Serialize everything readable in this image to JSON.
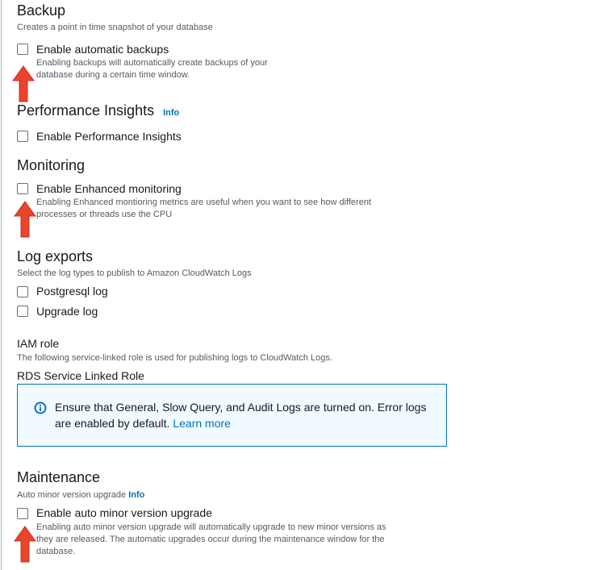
{
  "backup": {
    "title": "Backup",
    "description": "Creates a point in time snapshot of your database",
    "checkbox_label": "Enable automatic backups",
    "checkbox_desc_line1": "Enabling backups will automatically create backups of your",
    "checkbox_desc_line2": "database during a certain time window.",
    "checked": false
  },
  "performance_insights": {
    "title": "Performance Insights",
    "info_label": "Info",
    "checkbox_label": "Enable Performance Insights",
    "checked": false
  },
  "monitoring": {
    "title": "Monitoring",
    "checkbox_label": "Enable Enhanced monitoring",
    "checkbox_desc_line1": "Enabling Enhanced montioring metrics are useful when you want to see how different",
    "checkbox_desc_line2": "processes or threads use the CPU",
    "checked": false
  },
  "log_exports": {
    "title": "Log exports",
    "description": "Select the log types to publish to Amazon CloudWatch Logs",
    "options": [
      {
        "label": "Postgresql log",
        "checked": false
      },
      {
        "label": "Upgrade log",
        "checked": false
      }
    ]
  },
  "iam_role": {
    "title": "IAM role",
    "description": "The following service-linked role is used for publishing logs to CloudWatch Logs.",
    "role_name": "RDS Service Linked Role"
  },
  "alert": {
    "icon": "info-circle-icon",
    "text_line1": "Ensure that General, Slow Query, and Audit Logs are turned on. Error logs",
    "text_line2": "are enabled by default.",
    "link_label": "Learn more"
  },
  "maintenance": {
    "title": "Maintenance",
    "subtitle": "Auto minor version upgrade",
    "info_label": "Info",
    "checkbox_label": "Enable auto minor version upgrade",
    "checkbox_desc_line1": "Enabling auto minor version upgrade will automatically upgrade to new minor versions as",
    "checkbox_desc_line2": "they are released. The automatic upgrades occur during the maintenance window for the",
    "checkbox_desc_line3": "database.",
    "checked": false
  },
  "colors": {
    "link": "#0073bb",
    "arrow": "#e8452c",
    "alert_border": "#0073bb",
    "alert_bg": "#f1faff"
  }
}
